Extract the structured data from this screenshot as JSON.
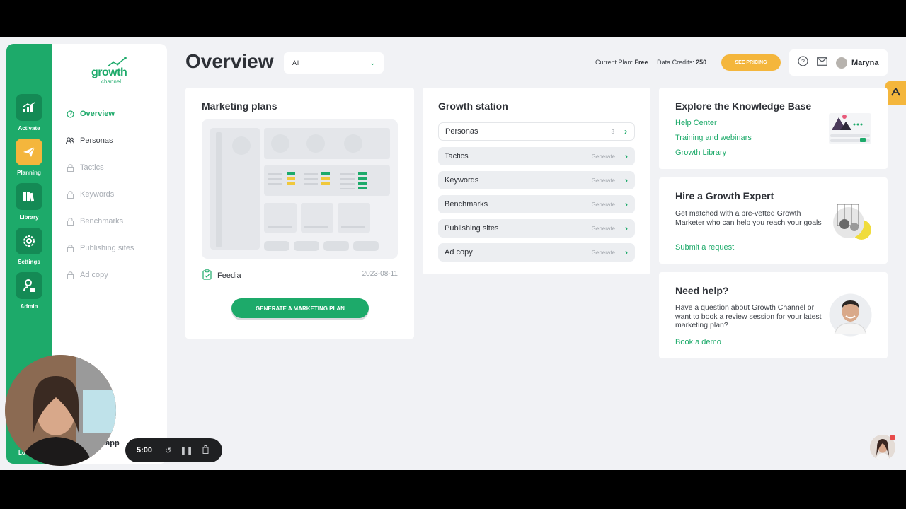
{
  "rail": {
    "items": [
      {
        "label": "Activate"
      },
      {
        "label": "Planning"
      },
      {
        "label": "Library"
      },
      {
        "label": "Settings"
      },
      {
        "label": "Admin"
      }
    ],
    "logout_partial": "Lo"
  },
  "logo": {
    "name": "growth",
    "sub": "channel"
  },
  "subnav": {
    "items": [
      {
        "label": "Overview"
      },
      {
        "label": "Personas"
      },
      {
        "label": "Tactics"
      },
      {
        "label": "Keywords"
      },
      {
        "label": "Benchmarks"
      },
      {
        "label": "Publishing sites"
      },
      {
        "label": "Ad copy"
      }
    ]
  },
  "header": {
    "title": "Overview",
    "filter_value": "All",
    "current_plan_label": "Current Plan:",
    "current_plan_value": "Free",
    "credits_label": "Data Credits:",
    "credits_value": "250",
    "pricing_button": "SEE PRICING",
    "user_name": "Maryna"
  },
  "marketing_plans": {
    "title": "Marketing plans",
    "plan_name": "Feedia",
    "plan_date": "2023-08-11",
    "generate_button": "GENERATE A MARKETING PLAN"
  },
  "growth_station": {
    "title": "Growth station",
    "rows": [
      {
        "label": "Personas",
        "meta": "3"
      },
      {
        "label": "Tactics",
        "meta": "Generate"
      },
      {
        "label": "Keywords",
        "meta": "Generate"
      },
      {
        "label": "Benchmarks",
        "meta": "Generate"
      },
      {
        "label": "Publishing sites",
        "meta": "Generate"
      },
      {
        "label": "Ad copy",
        "meta": "Generate"
      }
    ]
  },
  "knowledge_base": {
    "title": "Explore the Knowledge Base",
    "links": [
      "Help Center",
      "Training and webinars",
      "Growth Library"
    ]
  },
  "hire_expert": {
    "title": "Hire a Growth Expert",
    "text": "Get matched with a pre-vetted Growth Marketer who can help you reach your goals",
    "link": "Submit a request"
  },
  "need_help": {
    "title": "Need help?",
    "text": "Have a question about Growth Channel or want to book a review session for your latest marketing plan?",
    "link": "Book a demo"
  },
  "recorder": {
    "timer": "5:00",
    "behind_text": "y app"
  },
  "colors": {
    "brand_green": "#1daa6a",
    "accent_yellow": "#f4b63c"
  }
}
